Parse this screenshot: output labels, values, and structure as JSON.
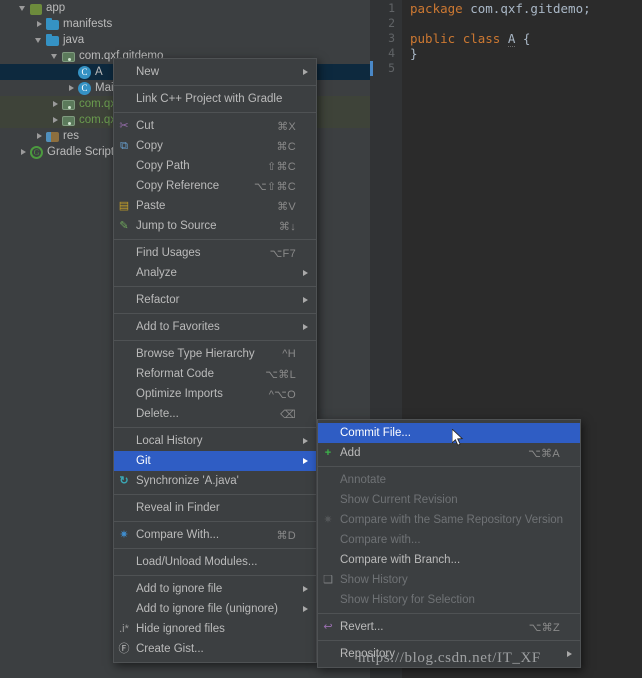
{
  "app": {
    "theme_bg": "#3c3f41",
    "accent_selection": "#2f5dc4",
    "tree_selection": "#0d293e"
  },
  "project_tree": {
    "items": [
      {
        "label": "app",
        "indent": 1,
        "arrow": "down",
        "icon": "app-module-icon",
        "state": "normal"
      },
      {
        "label": "manifests",
        "indent": 2,
        "arrow": "right",
        "icon": "folder-icon",
        "state": "normal"
      },
      {
        "label": "java",
        "indent": 2,
        "arrow": "down",
        "icon": "folder-icon",
        "state": "normal"
      },
      {
        "label": "com.qxf.gitdemo",
        "indent": 3,
        "arrow": "down",
        "icon": "package-icon",
        "state": "normal"
      },
      {
        "label": "A",
        "indent": 4,
        "arrow": "none",
        "icon": "class-icon",
        "state": "selected"
      },
      {
        "label": "MainA",
        "indent": 4,
        "arrow": "right",
        "icon": "class-icon",
        "state": "normal"
      },
      {
        "label": "com.qxf.",
        "indent": 3,
        "arrow": "right",
        "icon": "package-icon",
        "state": "added"
      },
      {
        "label": "com.qxf.",
        "indent": 3,
        "arrow": "right",
        "icon": "package-icon",
        "state": "added"
      },
      {
        "label": "res",
        "indent": 2,
        "arrow": "right",
        "icon": "res-folder-icon",
        "state": "normal"
      },
      {
        "label": "Gradle Scripts",
        "indent": 1,
        "arrow": "right",
        "icon": "gradle-icon",
        "state": "normal"
      }
    ]
  },
  "editor": {
    "line_numbers": [
      "1",
      "2",
      "3",
      "4",
      "5"
    ],
    "marker_line": 5,
    "lines": [
      {
        "tokens": [
          {
            "t": "package",
            "c": "kw"
          },
          {
            "t": " com.qxf.gitdemo;",
            "c": "plain"
          }
        ]
      },
      {
        "tokens": []
      },
      {
        "tokens": [
          {
            "t": "public",
            "c": "kw"
          },
          {
            "t": " ",
            "c": "plain"
          },
          {
            "t": "class",
            "c": "kw"
          },
          {
            "t": " ",
            "c": "plain"
          },
          {
            "t": "A",
            "c": "cls"
          },
          {
            "t": " {",
            "c": "plain"
          }
        ]
      },
      {
        "tokens": [
          {
            "t": "}",
            "c": "plain"
          }
        ]
      },
      {
        "tokens": []
      }
    ]
  },
  "context_menu": {
    "items": [
      {
        "label": "New",
        "icon": "",
        "shortcut": "",
        "submenu": true,
        "state": "normal"
      },
      {
        "type": "separator"
      },
      {
        "label": "Link C++ Project with Gradle",
        "icon": "",
        "shortcut": "",
        "submenu": false,
        "state": "normal"
      },
      {
        "type": "separator"
      },
      {
        "label": "Cut",
        "icon": "scissors-icon",
        "glyph": "✂",
        "iconclass": "g-scissors",
        "shortcut": "⌘X",
        "submenu": false,
        "state": "normal"
      },
      {
        "label": "Copy",
        "icon": "copy-icon",
        "glyph": "⧉",
        "iconclass": "g-copy",
        "shortcut": "⌘C",
        "submenu": false,
        "state": "normal"
      },
      {
        "label": "Copy Path",
        "icon": "",
        "shortcut": "⇧⌘C",
        "submenu": false,
        "state": "normal"
      },
      {
        "label": "Copy Reference",
        "icon": "",
        "shortcut": "⌥⇧⌘C",
        "submenu": false,
        "state": "normal"
      },
      {
        "label": "Paste",
        "icon": "paste-icon",
        "glyph": "▤",
        "iconclass": "g-paste",
        "shortcut": "⌘V",
        "submenu": false,
        "state": "normal"
      },
      {
        "label": "Jump to Source",
        "icon": "jump-to-source-icon",
        "glyph": "✎",
        "iconclass": "g-jump",
        "shortcut": "⌘↓",
        "submenu": false,
        "state": "normal"
      },
      {
        "type": "separator"
      },
      {
        "label": "Find Usages",
        "icon": "",
        "shortcut": "⌥F7",
        "submenu": false,
        "state": "normal"
      },
      {
        "label": "Analyze",
        "icon": "",
        "shortcut": "",
        "submenu": true,
        "state": "normal"
      },
      {
        "type": "separator"
      },
      {
        "label": "Refactor",
        "icon": "",
        "shortcut": "",
        "submenu": true,
        "state": "normal"
      },
      {
        "type": "separator"
      },
      {
        "label": "Add to Favorites",
        "icon": "",
        "shortcut": "",
        "submenu": true,
        "state": "normal"
      },
      {
        "type": "separator"
      },
      {
        "label": "Browse Type Hierarchy",
        "icon": "",
        "shortcut": "^H",
        "submenu": false,
        "state": "normal"
      },
      {
        "label": "Reformat Code",
        "icon": "",
        "shortcut": "⌥⌘L",
        "submenu": false,
        "state": "normal"
      },
      {
        "label": "Optimize Imports",
        "icon": "",
        "shortcut": "^⌥O",
        "submenu": false,
        "state": "normal"
      },
      {
        "label": "Delete...",
        "icon": "",
        "shortcut": "⌫",
        "submenu": false,
        "state": "normal"
      },
      {
        "type": "separator"
      },
      {
        "label": "Local History",
        "icon": "",
        "shortcut": "",
        "submenu": true,
        "state": "normal"
      },
      {
        "label": "Git",
        "icon": "",
        "shortcut": "",
        "submenu": true,
        "state": "selected"
      },
      {
        "label": "Synchronize 'A.java'",
        "icon": "synchronize-icon",
        "glyph": "↻",
        "iconclass": "g-sync",
        "shortcut": "",
        "submenu": false,
        "state": "normal"
      },
      {
        "type": "separator"
      },
      {
        "label": "Reveal in Finder",
        "icon": "",
        "shortcut": "",
        "submenu": false,
        "state": "normal"
      },
      {
        "type": "separator"
      },
      {
        "label": "Compare With...",
        "icon": "compare-icon",
        "glyph": "✷",
        "iconclass": "g-compare",
        "shortcut": "⌘D",
        "submenu": false,
        "state": "normal"
      },
      {
        "type": "separator"
      },
      {
        "label": "Load/Unload Modules...",
        "icon": "",
        "shortcut": "",
        "submenu": false,
        "state": "normal"
      },
      {
        "type": "separator"
      },
      {
        "label": "Add to ignore file",
        "icon": "",
        "shortcut": "",
        "submenu": true,
        "state": "normal"
      },
      {
        "label": "Add to ignore file (unignore)",
        "icon": "",
        "shortcut": "",
        "submenu": true,
        "state": "normal"
      },
      {
        "label": "Hide ignored files",
        "icon": "hide-ignored-icon",
        "glyph": ".i*",
        "iconclass": "g-ignore",
        "shortcut": "",
        "submenu": false,
        "state": "normal"
      },
      {
        "label": "Create Gist...",
        "icon": "gist-icon",
        "glyph": "Ⓕ",
        "iconclass": "g-gist",
        "shortcut": "",
        "submenu": false,
        "state": "normal"
      }
    ]
  },
  "git_submenu": {
    "items": [
      {
        "label": "Commit File...",
        "icon": "",
        "shortcut": "",
        "submenu": false,
        "state": "selected"
      },
      {
        "label": "Add",
        "icon": "add-icon",
        "glyph": "+",
        "iconclass": "g-add",
        "shortcut": "⌥⌘A",
        "submenu": false,
        "state": "normal"
      },
      {
        "type": "separator"
      },
      {
        "label": "Annotate",
        "icon": "",
        "shortcut": "",
        "submenu": false,
        "state": "disabled"
      },
      {
        "label": "Show Current Revision",
        "icon": "",
        "shortcut": "",
        "submenu": false,
        "state": "disabled"
      },
      {
        "label": "Compare with the Same Repository Version",
        "icon": "compare-icon",
        "glyph": "✷",
        "iconclass": "g-cmp-dim",
        "shortcut": "",
        "submenu": false,
        "state": "disabled"
      },
      {
        "label": "Compare with...",
        "icon": "",
        "shortcut": "",
        "submenu": false,
        "state": "disabled"
      },
      {
        "label": "Compare with Branch...",
        "icon": "",
        "shortcut": "",
        "submenu": false,
        "state": "normal"
      },
      {
        "label": "Show History",
        "icon": "show-history-icon",
        "glyph": "❑",
        "iconclass": "g-history",
        "shortcut": "",
        "submenu": false,
        "state": "disabled"
      },
      {
        "label": "Show History for Selection",
        "icon": "",
        "shortcut": "",
        "submenu": false,
        "state": "disabled"
      },
      {
        "type": "separator"
      },
      {
        "label": "Revert...",
        "icon": "revert-icon",
        "glyph": "↩",
        "iconclass": "g-revert",
        "shortcut": "⌥⌘Z",
        "submenu": false,
        "state": "normal"
      },
      {
        "type": "separator"
      },
      {
        "label": "Repository",
        "icon": "",
        "shortcut": "",
        "submenu": true,
        "state": "normal"
      }
    ]
  },
  "watermark": {
    "text": "https://blog.csdn.net/IT_XF"
  }
}
